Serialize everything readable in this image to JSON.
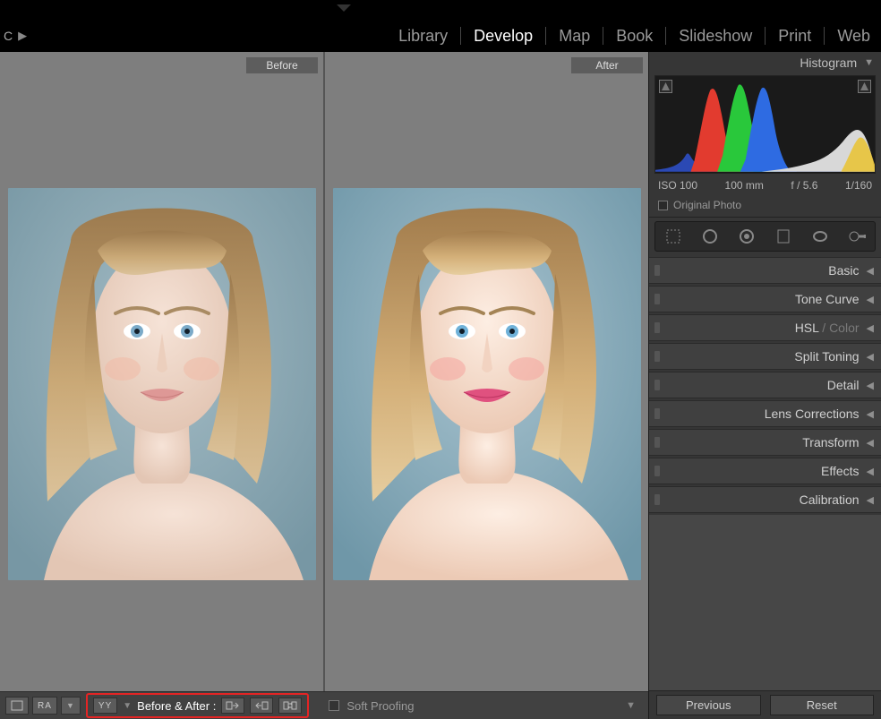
{
  "titlebar": {
    "crumb_letter": "C"
  },
  "modules": {
    "items": [
      "Library",
      "Develop",
      "Map",
      "Book",
      "Slideshow",
      "Print",
      "Web"
    ],
    "active": "Develop"
  },
  "compare": {
    "before_label": "Before",
    "after_label": "After"
  },
  "toolbar": {
    "ra_label": "RA",
    "yy_label": "YY",
    "before_after_label": "Before & After :",
    "soft_proofing_label": "Soft Proofing"
  },
  "right_panel": {
    "histogram_title": "Histogram",
    "exif": {
      "iso": "ISO 100",
      "focal": "100 mm",
      "aperture": "f / 5.6",
      "shutter": "1/160"
    },
    "original_photo_label": "Original Photo",
    "tools": [
      "crop",
      "spot",
      "redeye",
      "graduated",
      "radial",
      "adjust-brush"
    ],
    "panels": [
      {
        "label": "Basic",
        "dim": ""
      },
      {
        "label": "Tone Curve",
        "dim": ""
      },
      {
        "label": "HSL",
        "dim": " / Color"
      },
      {
        "label": "Split Toning",
        "dim": ""
      },
      {
        "label": "Detail",
        "dim": ""
      },
      {
        "label": "Lens Corrections",
        "dim": ""
      },
      {
        "label": "Transform",
        "dim": ""
      },
      {
        "label": "Effects",
        "dim": ""
      },
      {
        "label": "Calibration",
        "dim": ""
      }
    ],
    "previous_label": "Previous",
    "reset_label": "Reset"
  }
}
